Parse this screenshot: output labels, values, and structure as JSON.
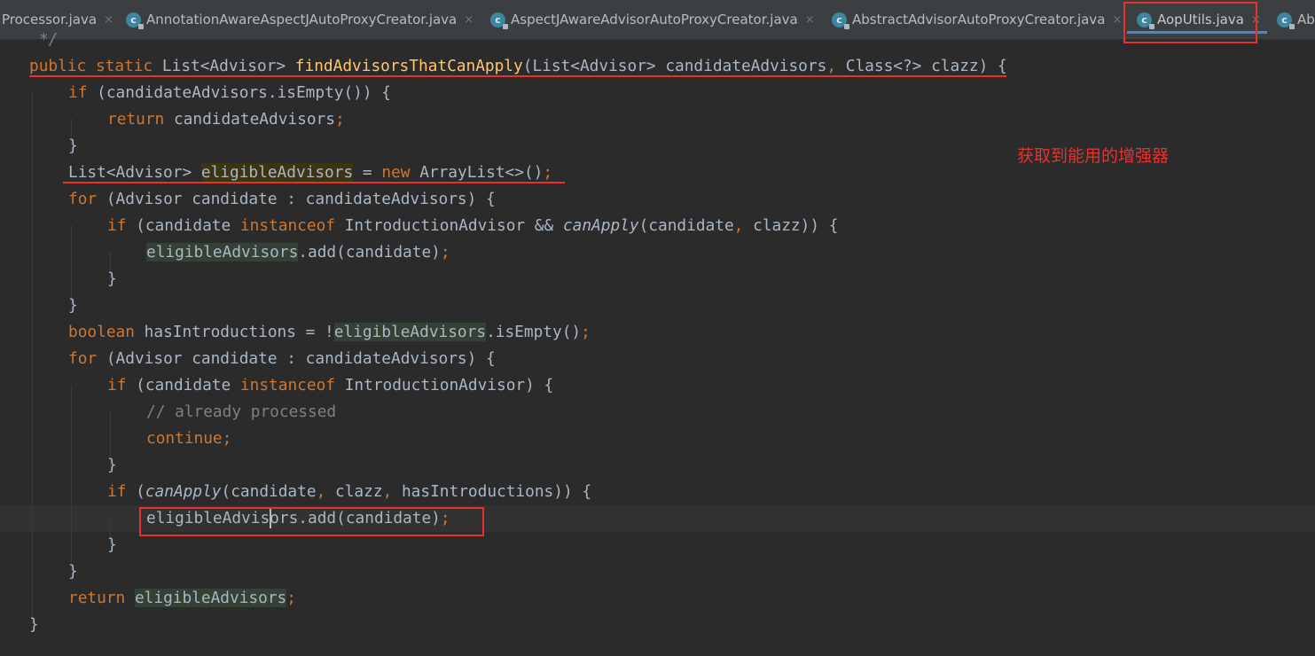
{
  "tabs": [
    {
      "label": "Processor.java",
      "icon": "class-icon",
      "active": false
    },
    {
      "label": "AnnotationAwareAspectJAutoProxyCreator.java",
      "icon": "class-icon",
      "active": false
    },
    {
      "label": "AspectJAwareAdvisorAutoProxyCreator.java",
      "icon": "class-icon",
      "active": false
    },
    {
      "label": "AbstractAdvisorAutoProxyCreator.java",
      "icon": "class-icon",
      "active": false
    },
    {
      "label": "AopUtils.java",
      "icon": "class-icon",
      "active": true
    },
    {
      "label": "Ab",
      "icon": "class-icon",
      "active": false
    }
  ],
  "close_glyph": "×",
  "annotation": "获取到能用的增强器",
  "colors": {
    "background": "#2b2b2b",
    "keyword": "#cc7832",
    "method_decl": "#ffc66d",
    "comment": "#808080",
    "default_text": "#a9b7c6",
    "markup_red": "#e8302f",
    "active_tab_underline": "#4a88c7"
  },
  "code": {
    "l0_comment_end": "*/",
    "l1_public": "public",
    "l1_static": "static",
    "l1_ret": "List<Advisor>",
    "l1_name": "findAdvisorsThatCanApply",
    "l1_params_a": "(List<Advisor> candidateAdvisors",
    "l1_comma": ",",
    "l1_params_b": "Class<?> clazz) {",
    "l2_if": "if",
    "l2_rest": "(candidateAdvisors.isEmpty()) {",
    "l3_return": "return",
    "l3_rest": "candidateAdvisors",
    "semi": ";",
    "close_brace": "}",
    "l5_type": "List<Advisor>",
    "l5_var": "eligibleAdvisors",
    "l5_eq": "=",
    "l5_new": "new",
    "l5_rest": "ArrayList<>()",
    "l6_for": "for",
    "l6_rest": "(Advisor candidate : candidateAdvisors) {",
    "l7_if": "if",
    "l7_a": "(candidate",
    "l7_instanceof": "instanceof",
    "l7_b": "IntroductionAdvisor &&",
    "l7_call": "canApply",
    "l7_c": "(candidate",
    "l7_d": "clazz)) {",
    "l8_var": "eligibleAdvisors",
    "l8_rest": ".add(candidate)",
    "l11_boolean": "boolean",
    "l11_a": "hasIntroductions = !",
    "l11_var": "eligibleAdvisors",
    "l11_rest": ".isEmpty()",
    "l12_for": "for",
    "l12_rest": "(Advisor candidate : candidateAdvisors) {",
    "l13_if": "if",
    "l13_a": "(candidate",
    "l13_instanceof": "instanceof",
    "l13_b": "IntroductionAdvisor) {",
    "l14_comment": "// already processed",
    "l15_continue": "continue",
    "l17_if": "if",
    "l17_call": "canApply",
    "l17_a": "(candidate",
    "l17_b": "clazz",
    "l17_c": "hasIntroductions)) {",
    "l18_var": "eligibleAdvisors",
    "l18_rest": ".add(candidate)",
    "l21_return": "return",
    "l21_var": "eligibleAdvisors"
  }
}
